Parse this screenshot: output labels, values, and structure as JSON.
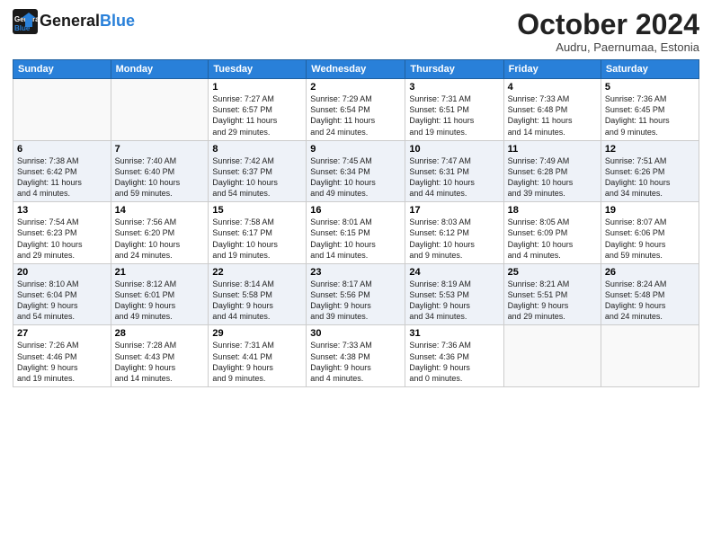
{
  "header": {
    "logo_line1": "General",
    "logo_line2": "Blue",
    "month": "October 2024",
    "location": "Audru, Paernumaa, Estonia"
  },
  "weekdays": [
    "Sunday",
    "Monday",
    "Tuesday",
    "Wednesday",
    "Thursday",
    "Friday",
    "Saturday"
  ],
  "weeks": [
    [
      {
        "day": "",
        "info": ""
      },
      {
        "day": "",
        "info": ""
      },
      {
        "day": "1",
        "info": "Sunrise: 7:27 AM\nSunset: 6:57 PM\nDaylight: 11 hours\nand 29 minutes."
      },
      {
        "day": "2",
        "info": "Sunrise: 7:29 AM\nSunset: 6:54 PM\nDaylight: 11 hours\nand 24 minutes."
      },
      {
        "day": "3",
        "info": "Sunrise: 7:31 AM\nSunset: 6:51 PM\nDaylight: 11 hours\nand 19 minutes."
      },
      {
        "day": "4",
        "info": "Sunrise: 7:33 AM\nSunset: 6:48 PM\nDaylight: 11 hours\nand 14 minutes."
      },
      {
        "day": "5",
        "info": "Sunrise: 7:36 AM\nSunset: 6:45 PM\nDaylight: 11 hours\nand 9 minutes."
      }
    ],
    [
      {
        "day": "6",
        "info": "Sunrise: 7:38 AM\nSunset: 6:42 PM\nDaylight: 11 hours\nand 4 minutes."
      },
      {
        "day": "7",
        "info": "Sunrise: 7:40 AM\nSunset: 6:40 PM\nDaylight: 10 hours\nand 59 minutes."
      },
      {
        "day": "8",
        "info": "Sunrise: 7:42 AM\nSunset: 6:37 PM\nDaylight: 10 hours\nand 54 minutes."
      },
      {
        "day": "9",
        "info": "Sunrise: 7:45 AM\nSunset: 6:34 PM\nDaylight: 10 hours\nand 49 minutes."
      },
      {
        "day": "10",
        "info": "Sunrise: 7:47 AM\nSunset: 6:31 PM\nDaylight: 10 hours\nand 44 minutes."
      },
      {
        "day": "11",
        "info": "Sunrise: 7:49 AM\nSunset: 6:28 PM\nDaylight: 10 hours\nand 39 minutes."
      },
      {
        "day": "12",
        "info": "Sunrise: 7:51 AM\nSunset: 6:26 PM\nDaylight: 10 hours\nand 34 minutes."
      }
    ],
    [
      {
        "day": "13",
        "info": "Sunrise: 7:54 AM\nSunset: 6:23 PM\nDaylight: 10 hours\nand 29 minutes."
      },
      {
        "day": "14",
        "info": "Sunrise: 7:56 AM\nSunset: 6:20 PM\nDaylight: 10 hours\nand 24 minutes."
      },
      {
        "day": "15",
        "info": "Sunrise: 7:58 AM\nSunset: 6:17 PM\nDaylight: 10 hours\nand 19 minutes."
      },
      {
        "day": "16",
        "info": "Sunrise: 8:01 AM\nSunset: 6:15 PM\nDaylight: 10 hours\nand 14 minutes."
      },
      {
        "day": "17",
        "info": "Sunrise: 8:03 AM\nSunset: 6:12 PM\nDaylight: 10 hours\nand 9 minutes."
      },
      {
        "day": "18",
        "info": "Sunrise: 8:05 AM\nSunset: 6:09 PM\nDaylight: 10 hours\nand 4 minutes."
      },
      {
        "day": "19",
        "info": "Sunrise: 8:07 AM\nSunset: 6:06 PM\nDaylight: 9 hours\nand 59 minutes."
      }
    ],
    [
      {
        "day": "20",
        "info": "Sunrise: 8:10 AM\nSunset: 6:04 PM\nDaylight: 9 hours\nand 54 minutes."
      },
      {
        "day": "21",
        "info": "Sunrise: 8:12 AM\nSunset: 6:01 PM\nDaylight: 9 hours\nand 49 minutes."
      },
      {
        "day": "22",
        "info": "Sunrise: 8:14 AM\nSunset: 5:58 PM\nDaylight: 9 hours\nand 44 minutes."
      },
      {
        "day": "23",
        "info": "Sunrise: 8:17 AM\nSunset: 5:56 PM\nDaylight: 9 hours\nand 39 minutes."
      },
      {
        "day": "24",
        "info": "Sunrise: 8:19 AM\nSunset: 5:53 PM\nDaylight: 9 hours\nand 34 minutes."
      },
      {
        "day": "25",
        "info": "Sunrise: 8:21 AM\nSunset: 5:51 PM\nDaylight: 9 hours\nand 29 minutes."
      },
      {
        "day": "26",
        "info": "Sunrise: 8:24 AM\nSunset: 5:48 PM\nDaylight: 9 hours\nand 24 minutes."
      }
    ],
    [
      {
        "day": "27",
        "info": "Sunrise: 7:26 AM\nSunset: 4:46 PM\nDaylight: 9 hours\nand 19 minutes."
      },
      {
        "day": "28",
        "info": "Sunrise: 7:28 AM\nSunset: 4:43 PM\nDaylight: 9 hours\nand 14 minutes."
      },
      {
        "day": "29",
        "info": "Sunrise: 7:31 AM\nSunset: 4:41 PM\nDaylight: 9 hours\nand 9 minutes."
      },
      {
        "day": "30",
        "info": "Sunrise: 7:33 AM\nSunset: 4:38 PM\nDaylight: 9 hours\nand 4 minutes."
      },
      {
        "day": "31",
        "info": "Sunrise: 7:36 AM\nSunset: 4:36 PM\nDaylight: 9 hours\nand 0 minutes."
      },
      {
        "day": "",
        "info": ""
      },
      {
        "day": "",
        "info": ""
      }
    ]
  ]
}
